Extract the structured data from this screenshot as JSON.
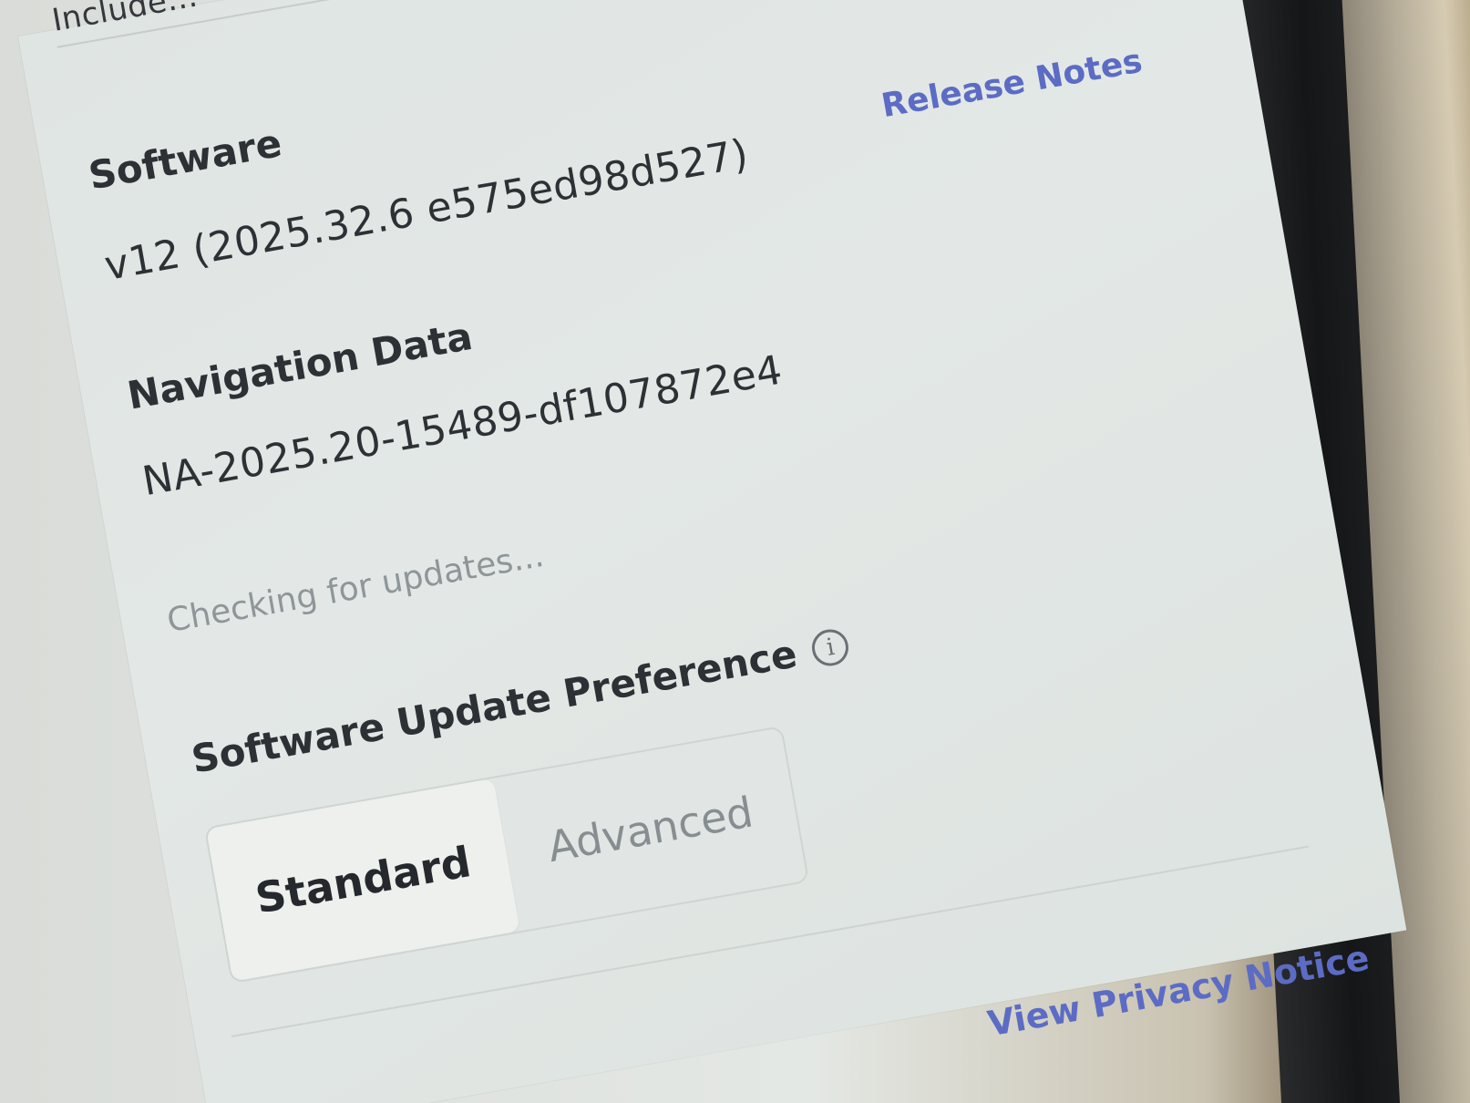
{
  "header": {
    "partial_text": "Include..."
  },
  "software": {
    "label": "Software",
    "version": "v12 (2025.32.6 e575ed98d527)",
    "release_notes": "Release Notes"
  },
  "navigation_data": {
    "label": "Navigation Data",
    "version": "NA-2025.20-15489-df107872e4"
  },
  "update_status": "Checking for updates...",
  "update_preference": {
    "label": "Software Update Preference",
    "info_icon": "info-icon",
    "options": [
      {
        "label": "Standard",
        "selected": true
      },
      {
        "label": "Advanced",
        "selected": false
      }
    ]
  },
  "footer": {
    "privacy_link": "View Privacy Notice"
  },
  "colors": {
    "link": "#5c6cc4",
    "text": "#2d3135",
    "muted": "#8e9699",
    "screen_bg": "#e3e8e6"
  }
}
